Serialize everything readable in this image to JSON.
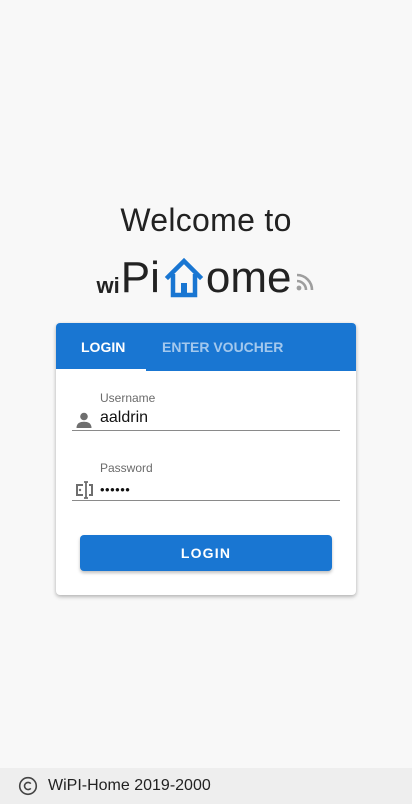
{
  "welcome": {
    "heading": "Welcome to"
  },
  "logo": {
    "prefix": "wi",
    "part1": "Pi",
    "house_icon": "house-icon",
    "part2": "ome",
    "signal_icon": "rss-icon",
    "accent_color": "#1976d2"
  },
  "tabs": {
    "login": "LOGIN",
    "voucher": "ENTER VOUCHER",
    "active": "LOGIN"
  },
  "form": {
    "username": {
      "label": "Username",
      "value": "aaldrin",
      "icon": "person-icon"
    },
    "password": {
      "label": "Password",
      "value": "••••••",
      "icon": "password-icon"
    },
    "submit_label": "LOGIN"
  },
  "footer": {
    "icon": "copyright-icon",
    "text": "WiPI-Home 2019-2000"
  },
  "colors": {
    "primary": "#1976d2",
    "background": "#f8f8f8"
  }
}
